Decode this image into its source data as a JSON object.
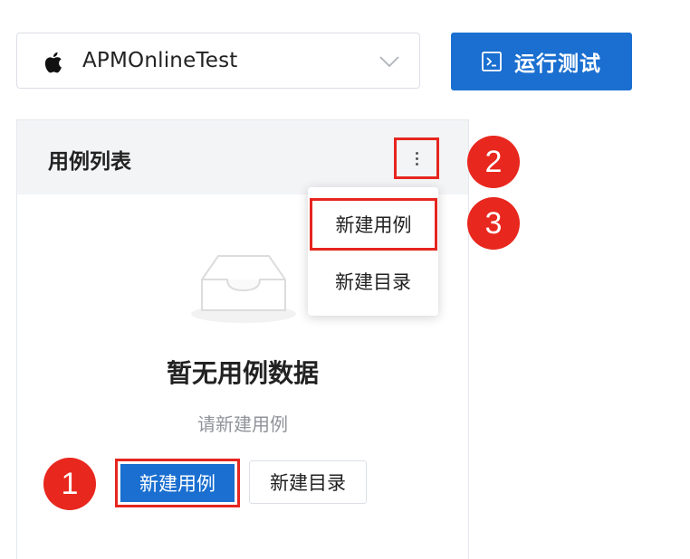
{
  "app_selector": {
    "platform_icon": "apple-icon",
    "app_name": "APMOnlineTest",
    "dropdown_icon": "chevron-down-icon"
  },
  "run_button": {
    "icon": "terminal-icon",
    "label": "运行测试"
  },
  "case_panel": {
    "title": "用例列表",
    "more_icon": "more-vertical-icon",
    "empty_icon": "empty-inbox-icon",
    "empty_title": "暂无用例数据",
    "empty_subtitle": "请新建用例",
    "new_case_button": "新建用例",
    "new_dir_button": "新建目录"
  },
  "dropdown_menu": {
    "items": [
      {
        "label": "新建用例"
      },
      {
        "label": "新建目录"
      }
    ]
  },
  "step_markers": [
    {
      "label": "1"
    },
    {
      "label": "2"
    },
    {
      "label": "3"
    }
  ],
  "colors": {
    "primary": "#1a6fd0",
    "highlight": "#e5261f",
    "marker": "#e8271e",
    "muted_text": "#909399"
  }
}
